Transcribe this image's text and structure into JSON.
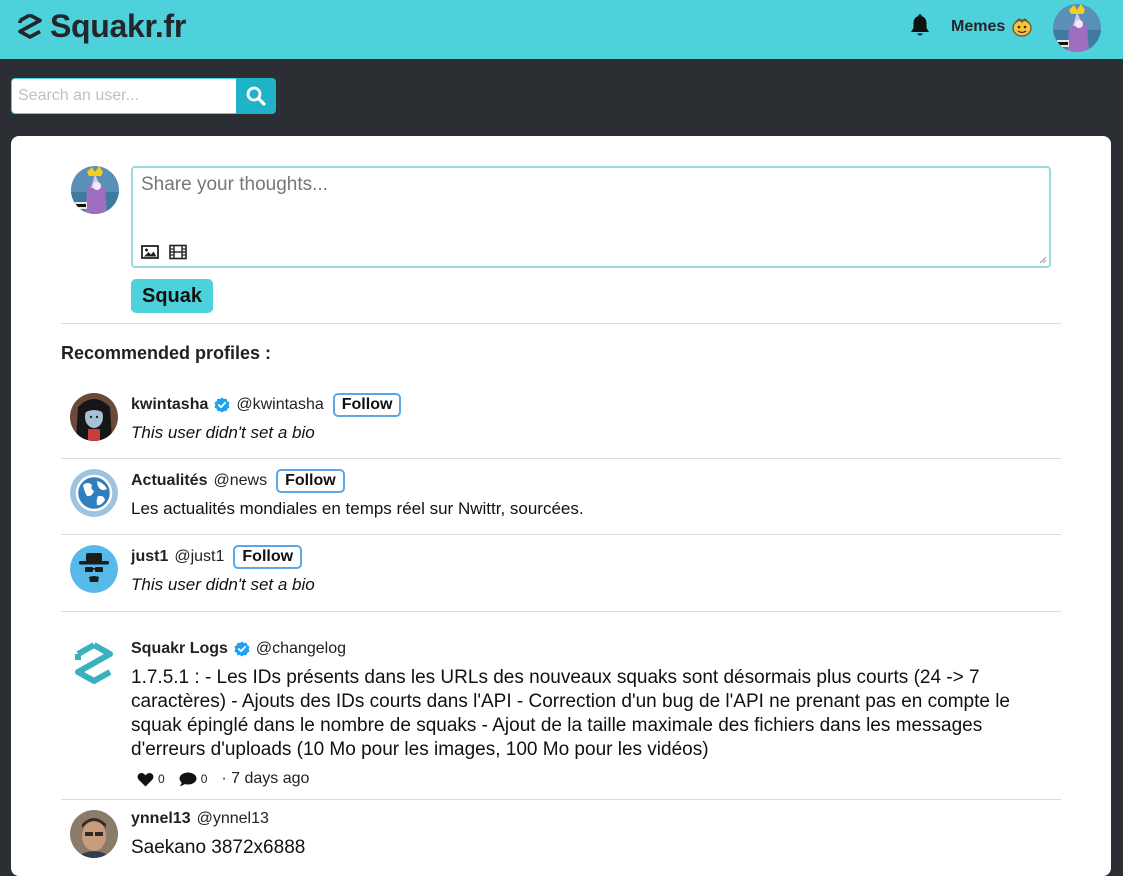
{
  "header": {
    "brand": "Squakr.fr",
    "memes_label": "Memes"
  },
  "search": {
    "placeholder": "Search an user..."
  },
  "compose": {
    "placeholder": "Share your thoughts...",
    "submit_label": "Squak"
  },
  "recommended": {
    "title": "Recommended profiles :",
    "follow_label": "Follow",
    "profiles": [
      {
        "name": "kwintasha",
        "handle": "@kwintasha",
        "bio": "This user didn't set a bio",
        "verified": true
      },
      {
        "name": "Actualités",
        "handle": "@news",
        "bio": "Les actualités mondiales en temps réel sur Nwittr, sourcées.",
        "verified": false
      },
      {
        "name": "just1",
        "handle": "@just1",
        "bio": "This user didn't set a bio",
        "verified": false
      }
    ]
  },
  "posts": [
    {
      "author": "Squakr Logs",
      "handle": "@changelog",
      "verified": true,
      "text": "1.7.5.1 : - Les IDs présents dans les URLs des nouveaux squaks sont désormais plus courts (24 -> 7 caractères) - Ajouts des IDs courts dans l'API - Correction d'un bug de l'API ne prenant pas en compte le squak épinglé dans le nombre de squaks - Ajout de la taille maximale des fichiers dans les messages d'erreurs d'uploads (10 Mo pour les images, 100 Mo pour les vidéos)",
      "likes": "0",
      "replies": "0",
      "time": "· 7 days ago"
    },
    {
      "author": "ynnel13",
      "handle": "@ynnel13",
      "verified": false,
      "text": "Saekano 3872x6888"
    }
  ],
  "colors": {
    "accent": "#4dd2dc",
    "search_button": "#1eb3c8",
    "background": "#2b2e33",
    "verified": "#1da1f2",
    "follow_border": "#5aa6e6"
  },
  "icons": {
    "brand": "dollar-s-logo-icon",
    "notifications": "bell-icon",
    "memes": "emoji-face-icon",
    "search": "search-icon",
    "image": "image-icon",
    "video": "film-icon",
    "like": "heart-icon",
    "reply": "comment-icon",
    "verified": "verified-check-icon"
  }
}
